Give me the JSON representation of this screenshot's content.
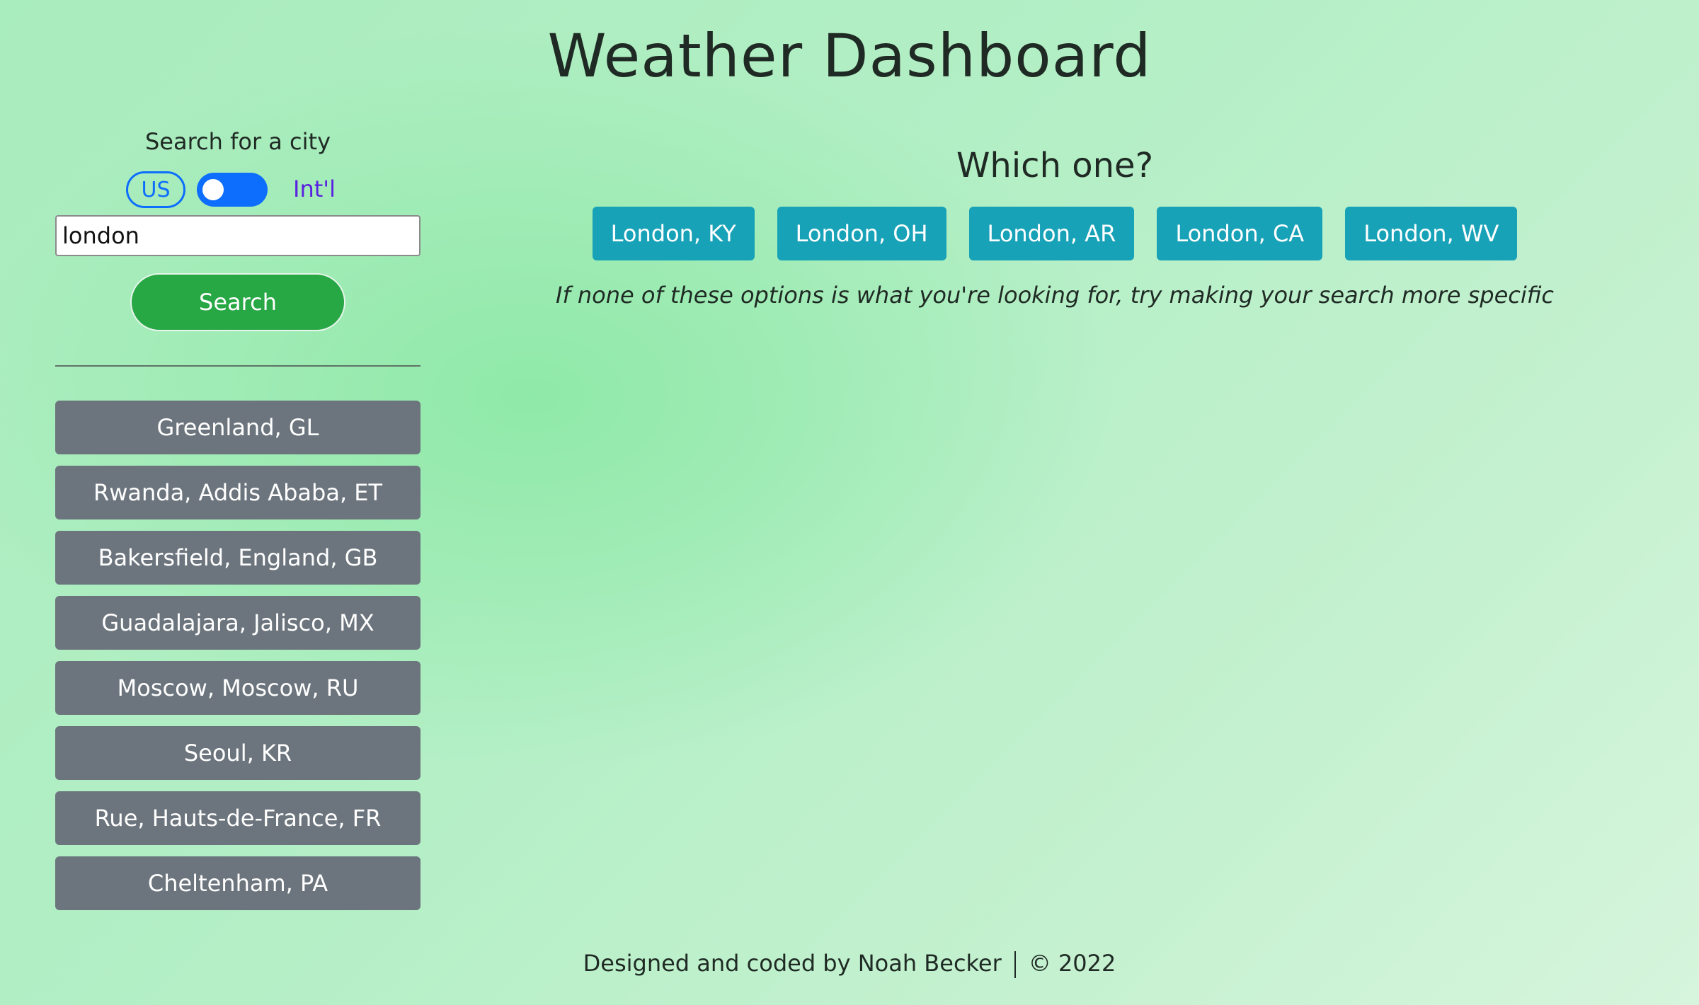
{
  "page": {
    "title": "Weather Dashboard"
  },
  "sidebar": {
    "search_label": "Search for a city",
    "toggle": {
      "left_label": "US",
      "right_label": "Int'l",
      "state": "US"
    },
    "search_input": {
      "value": "london",
      "placeholder": ""
    },
    "search_button_label": "Search",
    "history": [
      "Greenland, GL",
      "Rwanda, Addis Ababa, ET",
      "Bakersfield, England, GB",
      "Guadalajara, Jalisco, MX",
      "Moscow, Moscow, RU",
      "Seoul, KR",
      "Rue, Hauts-de-France, FR",
      "Cheltenham, PA"
    ]
  },
  "main": {
    "heading": "Which one?",
    "options": [
      "London, KY",
      "London, OH",
      "London, AR",
      "London, CA",
      "London, WV"
    ],
    "hint": "If none of these options is what you're looking for, try making your search more specific"
  },
  "footer": {
    "credit": "Designed and coded by Noah Becker",
    "copyright": "© 2022"
  },
  "colors": {
    "search_button": "#28a745",
    "history_button": "#6c757d",
    "option_button": "#17a2b8",
    "toggle_accent": "#0d6efd",
    "intl_label": "#5b21e0"
  }
}
